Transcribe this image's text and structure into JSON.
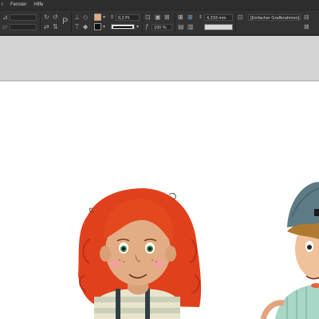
{
  "menubar": {
    "items": [
      "r",
      "Fenster",
      "Hilfe"
    ]
  },
  "control_panel": {
    "stroke_weight": "0,2 Pt",
    "scale_percent": "100 %",
    "offset_value": "4,233 mm",
    "object_style": "[Einfacher Grafikrahmen]+",
    "fill_color": "#e8a87c",
    "stroke_color": "#111111"
  },
  "canvas": {
    "pasteboard_color": "#d4d4d4",
    "page_color": "#ffffff",
    "artwork": [
      "girl-illustration",
      "boy-illustration"
    ]
  }
}
